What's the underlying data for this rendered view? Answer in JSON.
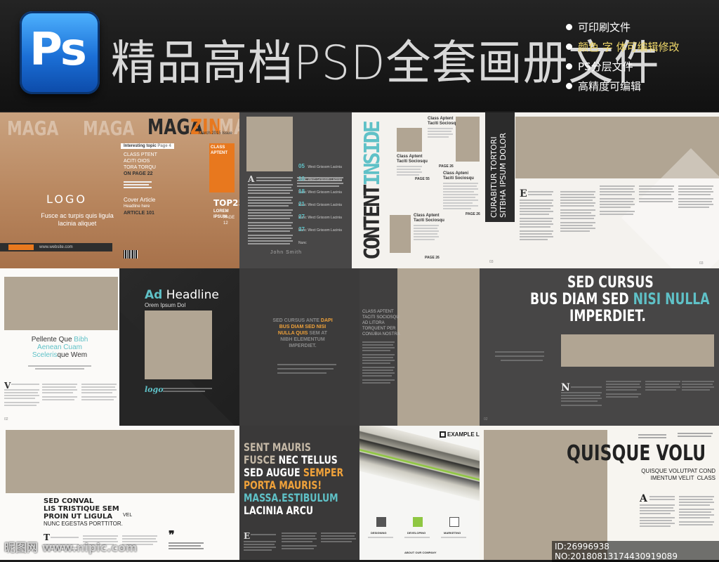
{
  "banner": {
    "icon_text": "Ps",
    "title": "精品高档PSD全套画册文件",
    "features": [
      "可印刷文件",
      "颜色 字 体可编辑修改",
      "PS分层文件",
      "高精度可编辑"
    ]
  },
  "p1": {
    "bg_word": "MAGAZIN",
    "masthead_a": "MAGA",
    "masthead_b": "ZIN",
    "masthead_c": "MA",
    "issue": "March 2015 Issue",
    "topic": "Interesting topic",
    "topic_page": "Page 4",
    "list": [
      "CLASS PTENT",
      "ACITI OIOS",
      "TORA TORQU"
    ],
    "on_page": "ON PAGE 22",
    "logo": "LOGO",
    "cover_article": "Cover Article",
    "headline_here": "Headline here",
    "article": "ARTICLE 101",
    "headline": "Fusce ac turpis quis ligula\nlacinia aliquet",
    "class_aptent": "CLASS APTENT",
    "top": "TOP25",
    "lorem": "LOREM IPSUM",
    "page": "PAGE 12",
    "site": "www.website.com"
  },
  "p2": {
    "dropcap": "A",
    "author": "John Smith",
    "toc": [
      {
        "num": "05",
        "text": "Wect Grissom Lacinia Nunc"
      },
      {
        "num": "10",
        "text": "Wect Grissom Lacinia Nunc"
      },
      {
        "num": "18",
        "text": "Wect Grissom Lacinia Nunc"
      },
      {
        "num": "21",
        "text": "Wect Grissom Lacinia Nunc"
      },
      {
        "num": "27",
        "text": "Wect Grissom Lacinia Nunc"
      },
      {
        "num": "37",
        "text": "Wect Grissom Lacinia Nunc"
      }
    ]
  },
  "p3": {
    "content": "CONTENT",
    "inside": "INSIDE",
    "items": [
      {
        "title": "Class Aptent\nTaciti Sociosqu",
        "page": "PAGE 55"
      },
      {
        "title": "Class Aptent\nTaciti Sociosqu",
        "page": "PAGE 26"
      },
      {
        "title": "Class Apteni\nTaciti Sociosqu",
        "page": "PAGE 26"
      },
      {
        "title": "Class Aptent\nTaciti Sociosqu",
        "page": "PAGE 26"
      }
    ],
    "vertical_title": "CURABITUR TORTORI\nSITBHA IPSUM DOLOR",
    "page_no": "03"
  },
  "p4": {
    "dropcap": "E",
    "page_no": "03"
  },
  "r2": {
    "pellente": [
      "Pellente Que ",
      "Bibh",
      "Aenean Cuam",
      "Sceleris",
      "que Wem"
    ],
    "dropcap_v": "V",
    "page_a": "02",
    "ad": "Ad",
    "headline": " Headline",
    "orem": "Orem Ipsum Dol",
    "logo": "logo",
    "quote": [
      "SED CURSUS ANTE ",
      "DAPI",
      "BUS DIAM SED NISI",
      "NULLA QUIS",
      " SEM AT",
      "NIBH ELEMENTUM",
      "IMPERDIET."
    ],
    "class_list": "CLASS APTENT\nTACITI SOCIOSQU\nAD LITORA\nTORQUENT PER\nCONUBIA NOSTRA",
    "big1": "SED CURSUS",
    "big2a": "BUS DIAM SED ",
    "big2b": "NISI NULLA",
    "big3": "IMPERDIET.",
    "dropcap_n": "N",
    "page_b": "02"
  },
  "r3": {
    "sed_conval": "SED CONVAL\nLIS TRISTIQUE SEM\nPROIN UT LIGULA",
    "vel": " VEL",
    "nunc": "NUNC EGESTAS PORTTITOR.",
    "dropcap_t": "T",
    "quote_mark": "❞",
    "mauris": [
      {
        "t": "SENT MAURIS",
        "c": "#c4b8a6"
      },
      {
        "t": "FUSCE ",
        "c": "#c4b8a6",
        "t2": "NEC TELLUS",
        "c2": "#ffffff"
      },
      {
        "t": "SED AUGUE ",
        "c": "#ffffff",
        "t2": "SEMPER",
        "c2": "#f0a23a"
      },
      {
        "t": "PORTA MAURIS!",
        "c": "#f0a23a"
      },
      {
        "t": "MASSA.ESTIBULUM",
        "c": "#5fc1c7"
      },
      {
        "t": "LACINIA ARCU",
        "c": "#ffffff"
      }
    ],
    "dropcap_e": "E",
    "example_logo": "EXAMPLE LOGO",
    "icons": [
      "DESIGNING",
      "DEVELOPING",
      "MARKETING"
    ],
    "about": "ABOUT OUR COMPANY",
    "quisque": "QUISQUE VOLU",
    "sub": "QUISQUE VOLUTPAT COND\nIMENTUM VELIT  CLASS",
    "dropcap_a": "A"
  },
  "footer": {
    "watermark": "昵图网 www.nipic.com",
    "id": "ID:26996938 NO:20180813174430919089"
  },
  "colors": {
    "accent_teal": "#5fc1c7",
    "accent_orange": "#f0a23a",
    "placeholder": "#b1a593"
  }
}
